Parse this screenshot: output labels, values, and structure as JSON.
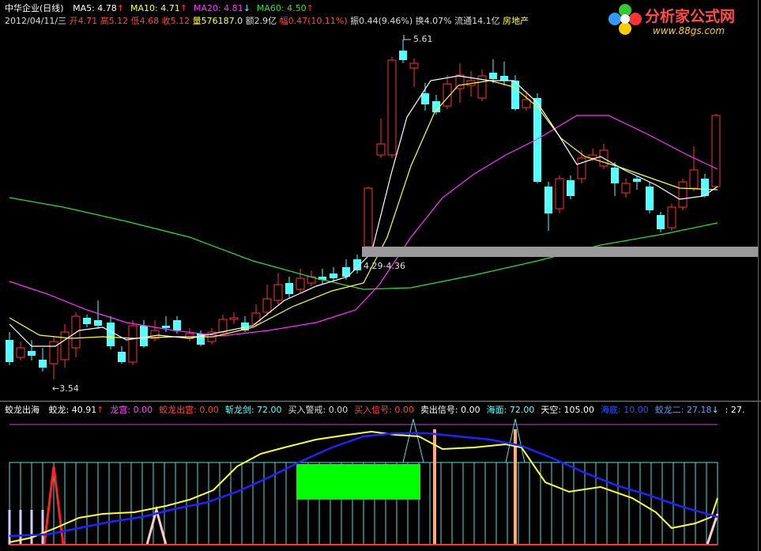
{
  "header": {
    "title": "中华企业(日线)",
    "ma": [
      {
        "label": "MA5: 4.78",
        "arrow": "↑",
        "color": "#ffffff"
      },
      {
        "label": "MA10: 4.71",
        "arrow": "↑",
        "color": "#ffff44"
      },
      {
        "label": "MA20: 4.81",
        "arrow": "↓",
        "color": "#ff33ff"
      },
      {
        "label": "MA60: 4.50",
        "arrow": "↑",
        "color": "#33dd33"
      }
    ],
    "date": "2012/04/11/三",
    "open": "开4.71",
    "high": "高5.12",
    "low": "低4.68",
    "close": "收5.12",
    "volume": "量576187.0",
    "amount": "额2.9亿",
    "change": "幅0.47(10.11%)",
    "amplitude": "振0.44(9.46%)",
    "turnover": "换4.07%",
    "float": "流通14.1亿",
    "sector": "房地产"
  },
  "logo": {
    "name": "分析家公式网",
    "url": "www.88gs.com"
  },
  "main_chart": {
    "high_label": "5.61",
    "low_label": "3.54",
    "range_label": "4.29-4.36"
  },
  "indicator": {
    "title": "蛟龙出海",
    "items": [
      {
        "label": "蛟龙: 40.91",
        "arrow": "↑",
        "color": "#ffffff"
      },
      {
        "label": "龙宫: 0.00",
        "arrow": "",
        "color": "#ff44ff"
      },
      {
        "label": "蛟龙出宫: 0.00",
        "arrow": "",
        "color": "#ff4444"
      },
      {
        "label": "斩龙剑: 72.00",
        "arrow": "",
        "color": "#66ffff"
      },
      {
        "label": "买入警戒: 0.00",
        "arrow": "",
        "color": "#dddddd"
      },
      {
        "label": "买入信号: 0.00",
        "arrow": "",
        "color": "#ff4444"
      },
      {
        "label": "卖出信号: 0.00",
        "arrow": "",
        "color": "#ffffff"
      },
      {
        "label": "海面: 72.00",
        "arrow": "",
        "color": "#66ffff"
      },
      {
        "label": "天空: 105.00",
        "arrow": "",
        "color": "#ffffff"
      },
      {
        "label": "海底: 10.00",
        "arrow": "",
        "color": "#3355ff"
      },
      {
        "label": "蛟龙二: 27.18",
        "arrow": "↓",
        "color": "#6699ff"
      },
      {
        "label": ": 27.",
        "arrow": "",
        "color": "#ffffff"
      }
    ]
  },
  "colors": {
    "up": "#ff3333",
    "down": "#55ffff",
    "ma5": "#ffffff",
    "ma10": "#ffff44",
    "ma20": "#ff33ff",
    "ma60": "#33dd33",
    "support_band": "#9a9a9a"
  }
}
